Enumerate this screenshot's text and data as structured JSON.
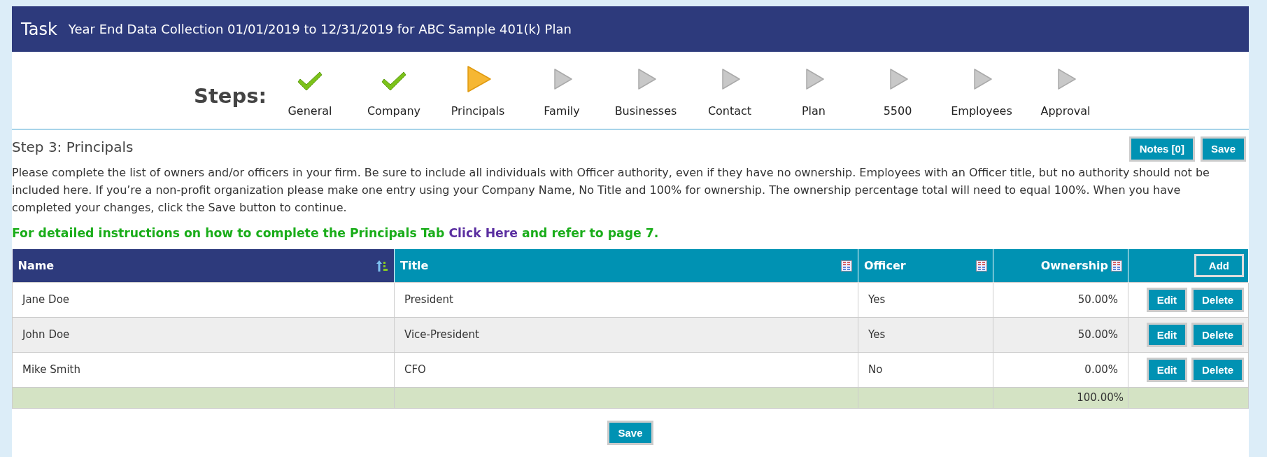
{
  "header": {
    "label": "Task",
    "title": "Year End Data Collection 01/01/2019 to 12/31/2019 for ABC Sample 401(k) Plan"
  },
  "steps": {
    "label": "Steps:",
    "items": [
      {
        "name": "General",
        "completed": true,
        "current": false
      },
      {
        "name": "Company",
        "completed": true,
        "current": false
      },
      {
        "name": "Principals",
        "completed": false,
        "current": true
      },
      {
        "name": "Family",
        "completed": false,
        "current": false
      },
      {
        "name": "Businesses",
        "completed": false,
        "current": false
      },
      {
        "name": "Contact",
        "completed": false,
        "current": false
      },
      {
        "name": "Plan",
        "completed": false,
        "current": false
      },
      {
        "name": "5500",
        "completed": false,
        "current": false
      },
      {
        "name": "Employees",
        "completed": false,
        "current": false
      },
      {
        "name": "Approval",
        "completed": false,
        "current": false
      }
    ]
  },
  "section": {
    "title": "Step 3: Principals",
    "buttons": [
      "Notes [0]",
      "Save"
    ],
    "description": "Please complete the list of owners and/or officers in your firm. Be sure to include all individuals with Officer authority, even if they have no ownership. Employees with an Officer title, but no authority should not be included here. If you’re a non-profit organization please make one entry using your Company Name, No Title and 100% for ownership. The ownership percentage total will need to equal 100%. When you have completed your changes, click the Save button to continue.",
    "instructions": {
      "before": "For detailed instructions on how to complete the Principals Tab",
      "link": "Click Here",
      "after": "and refer to page 7."
    }
  },
  "table": {
    "columns": [
      {
        "label": "Name",
        "sorted": true
      },
      {
        "label": "Title",
        "sorted": false
      },
      {
        "label": "Officer",
        "sorted": false
      },
      {
        "label": "Ownership",
        "sorted": false
      }
    ],
    "add_button": "Add",
    "rows": [
      {
        "name": "Jane Doe",
        "title": "President",
        "officer": "Yes",
        "ownership": "50.00%",
        "actions": [
          "Edit",
          "Delete"
        ]
      },
      {
        "name": "John Doe",
        "title": "Vice-President",
        "officer": "Yes",
        "ownership": "50.00%",
        "actions": [
          "Edit",
          "Delete"
        ]
      },
      {
        "name": "Mike Smith",
        "title": "CFO",
        "officer": "No",
        "ownership": "0.00%",
        "actions": [
          "Edit",
          "Delete"
        ]
      }
    ],
    "total": {
      "ownership": "100.00%"
    }
  },
  "footer": {
    "save_button": "Save"
  }
}
